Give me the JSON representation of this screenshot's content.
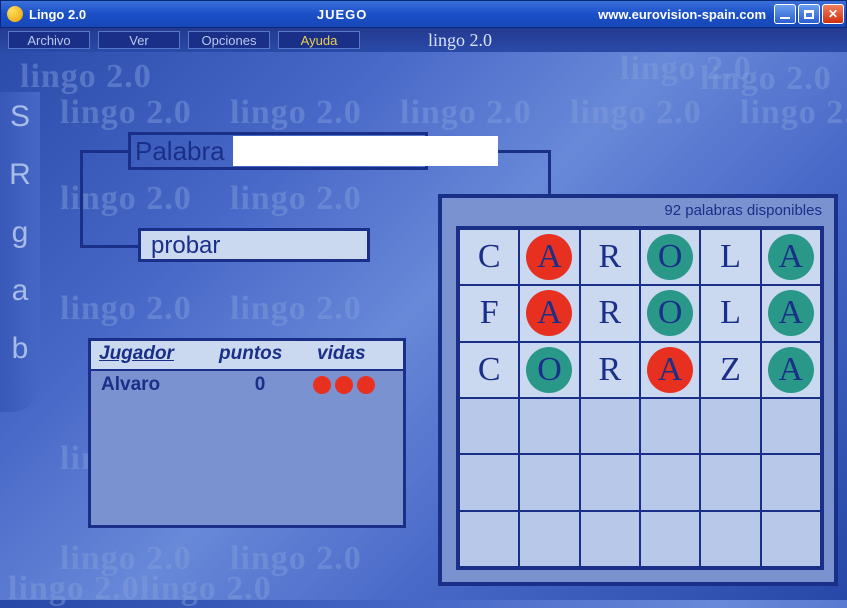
{
  "titlebar": {
    "app": "Lingo 2.0",
    "center": "JUEGO",
    "url": "www.eurovision-spain.com"
  },
  "menu": {
    "archivo": "Archivo",
    "ver": "Ver",
    "opciones": "Opciones",
    "ayuda": "Ayuda",
    "brand": "lingo 2.0"
  },
  "watermark": "lingo 2.0",
  "side_letters": [
    "S",
    "R",
    "g",
    "a",
    "b"
  ],
  "input": {
    "label": "Palabra",
    "value": "",
    "submit": "probar"
  },
  "score": {
    "headers": {
      "player": "Jugador",
      "points": "puntos",
      "lives": "vidas"
    },
    "rows": [
      {
        "name": "Alvaro",
        "points": "0",
        "lives": 3
      }
    ]
  },
  "grid": {
    "available_label": "92 palabras disponibles",
    "rows": [
      [
        {
          "l": "C"
        },
        {
          "l": "A",
          "c": "red"
        },
        {
          "l": "R"
        },
        {
          "l": "O",
          "c": "green"
        },
        {
          "l": "L"
        },
        {
          "l": "A",
          "c": "green"
        }
      ],
      [
        {
          "l": "F"
        },
        {
          "l": "A",
          "c": "red"
        },
        {
          "l": "R"
        },
        {
          "l": "O",
          "c": "green"
        },
        {
          "l": "L"
        },
        {
          "l": "A",
          "c": "green"
        }
      ],
      [
        {
          "l": "C"
        },
        {
          "l": "O",
          "c": "green"
        },
        {
          "l": "R"
        },
        {
          "l": "A",
          "c": "red"
        },
        {
          "l": "Z"
        },
        {
          "l": "A",
          "c": "green"
        }
      ],
      [
        {},
        {},
        {},
        {},
        {},
        {}
      ],
      [
        {},
        {},
        {},
        {},
        {},
        {}
      ],
      [
        {},
        {},
        {},
        {},
        {},
        {}
      ]
    ]
  }
}
